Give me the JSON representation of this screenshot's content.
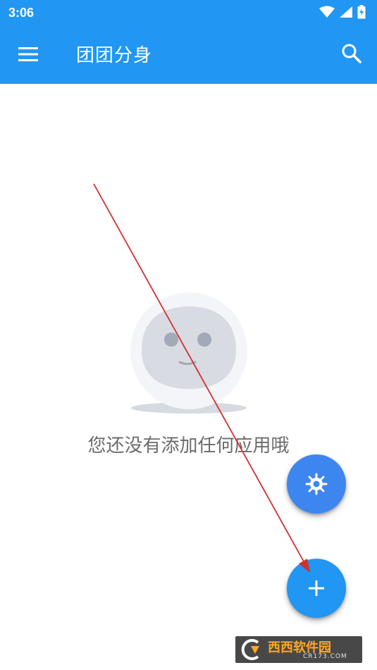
{
  "status_bar": {
    "time": "3:06",
    "icons": [
      "wifi-icon",
      "cell-signal-icon",
      "battery-charging-icon"
    ]
  },
  "app_bar": {
    "title": "团团分身",
    "menu_icon": "hamburger-menu-icon",
    "search_icon": "search-icon",
    "color": "#2196f3"
  },
  "empty_state": {
    "illustration": "smiling-face-placeholder",
    "message": "您还没有添加任何应用哦"
  },
  "fabs": {
    "settings_icon": "gear-icon",
    "settings_color": "#3d86f0",
    "add_icon": "plus-icon",
    "add_color": "#2196f3"
  },
  "annotation": {
    "type": "arrow",
    "color": "#d32f2f"
  },
  "watermark": {
    "title": "西西软件园",
    "url": "CR173.COM"
  }
}
